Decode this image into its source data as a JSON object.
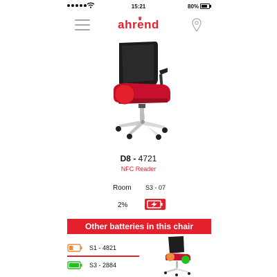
{
  "status_bar": {
    "time": "15:21",
    "battery": "80%"
  },
  "navbar": {
    "logo": "ahrend"
  },
  "device": {
    "code": "D8 - ",
    "number": "4721",
    "type": "NFC Reader"
  },
  "details": {
    "room_label": "Room",
    "room_value": "S3 - 07",
    "battery_percent": "2%"
  },
  "section_title": "Other batteries in this chair",
  "other_batteries": [
    {
      "label": "S1 - 4821",
      "status": "orange",
      "level": 0.4,
      "color": "#f08a3c"
    },
    {
      "label": "S3 - 2884",
      "status": "green",
      "level": 1.0,
      "color": "#22c11c"
    }
  ],
  "colors": {
    "accent": "#e3202c",
    "menu_icon": "#a7a7a7"
  },
  "icons": [
    "menu-icon",
    "location-pin-icon",
    "charging-icon",
    "battery-orange-icon",
    "battery-green-icon",
    "wifi-icon"
  ]
}
